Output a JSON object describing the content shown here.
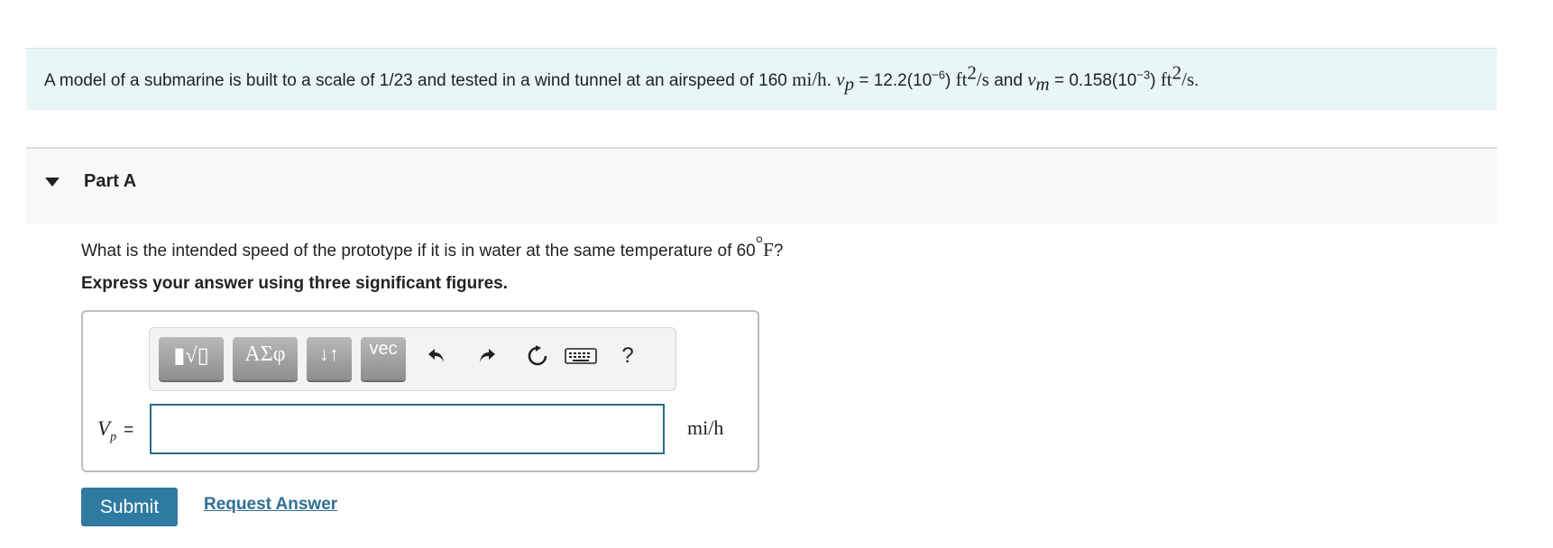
{
  "problem": {
    "intro": "A model of a submarine is built to a scale of 1/23 and tested in a wind tunnel at an airspeed of 160",
    "speed_unit": "mi/h",
    "sep1": ". ",
    "nu_symbol": "ν",
    "p_sub": "p",
    "eq_p": " = 12.2(10",
    "exp_p": "−6",
    "close_p": ") ",
    "ft": "ft",
    "sq": "2",
    "per_s": "/s",
    "and": " and ",
    "m_sub": "m",
    "eq_m": " = 0.158(10",
    "exp_m": "−3",
    "close_m": ") ",
    "end": "."
  },
  "part": {
    "title": "Part A"
  },
  "question": {
    "text": "What is the intended speed of the prototype if it is in water at the same temperature of 60",
    "degree": "°",
    "unit": "F",
    "qmark": "?"
  },
  "instruction": "Express your answer using three significant figures.",
  "toolbar": {
    "templates_label": "▮√▯",
    "greek_label": "ΑΣφ",
    "arrows_label": "↓↑",
    "vec_label": "vec",
    "undo_icon": "undo-icon",
    "redo_icon": "redo-icon",
    "reset_icon": "reset-icon",
    "keyboard_icon": "keyboard-icon",
    "help_label": "?"
  },
  "answer": {
    "var": "V",
    "var_sub": "p",
    "equals": "=",
    "value": "",
    "unit": "mi/h"
  },
  "buttons": {
    "submit": "Submit",
    "request_answer": "Request Answer"
  }
}
